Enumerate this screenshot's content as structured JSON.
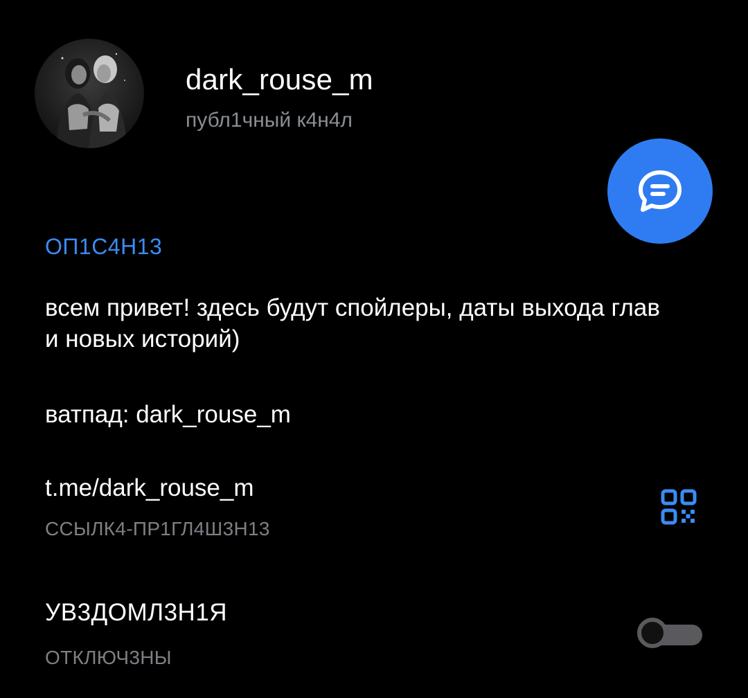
{
  "channel": {
    "name": "dark_rouse_m",
    "subtitle": "публ1чный к4н4л",
    "avatar_icon": "channel-avatar-photo"
  },
  "actions": {
    "chat_icon": "chat-bubble-icon",
    "chat_color": "#2f7cf2"
  },
  "description": {
    "title": "ОП1С4Н13",
    "title_color": "#3b8cf5",
    "text": "всем привет! здесь будут спойлеры, даты выхода глав и новых историй)",
    "wattpad": "ватпад: dark_rouse_m"
  },
  "invite_link": {
    "value": "t.me/dark_rouse_m",
    "caption": "ССЫЛК4-ПР1ГЛ4Ш3Н13",
    "qr_icon": "qr-code-icon"
  },
  "notifications": {
    "title": "УВ3ДОМЛ3Н1Я",
    "status": "ОТКЛЮЧ3НЫ",
    "enabled": false
  }
}
